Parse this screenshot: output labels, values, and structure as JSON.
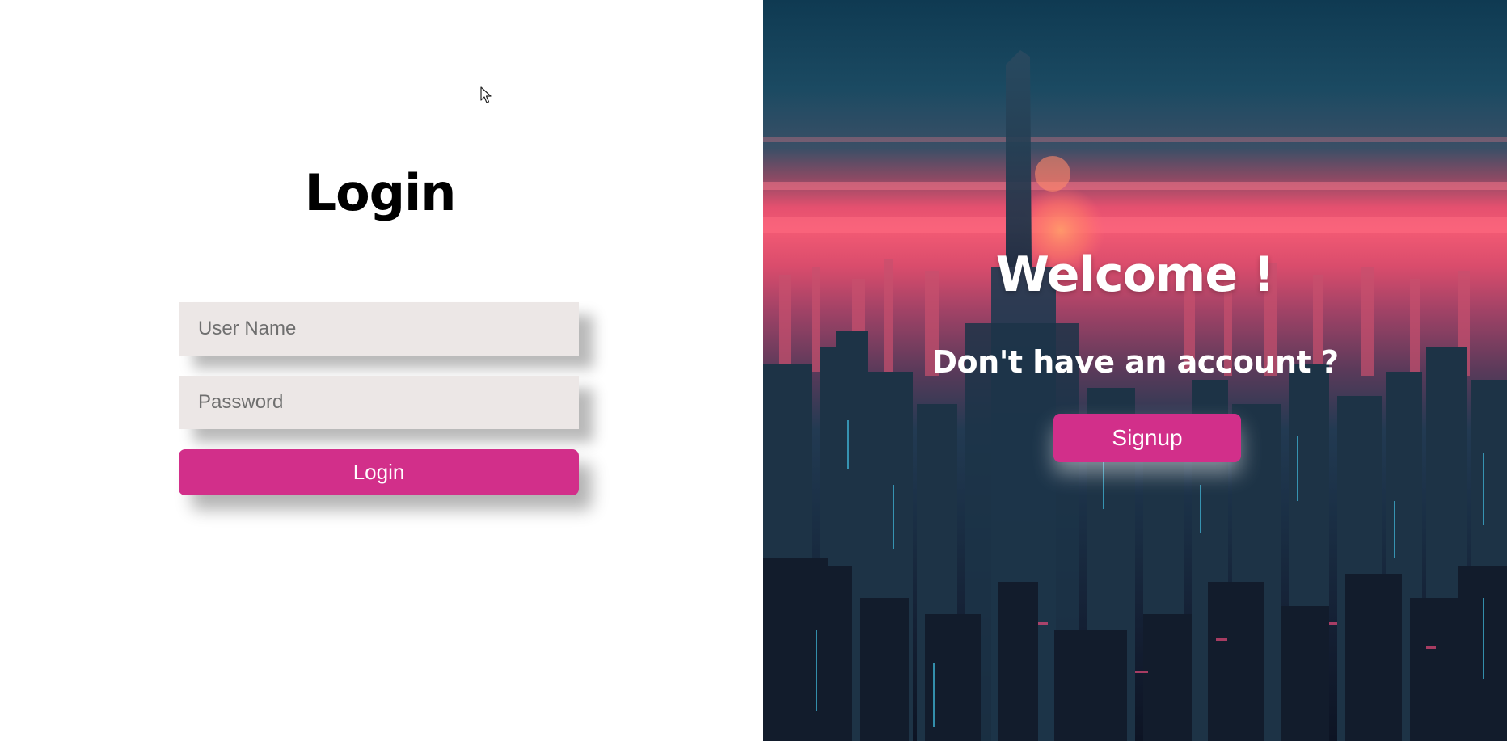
{
  "login_panel": {
    "title": "Login",
    "username_placeholder": "User Name",
    "password_placeholder": "Password",
    "login_button_label": "Login"
  },
  "welcome_panel": {
    "title": "Welcome !",
    "subtitle": "Don't have an account ?",
    "signup_button_label": "Signup"
  },
  "colors": {
    "accent": "#d22f8a",
    "field_background": "#ece7e6",
    "left_background": "#ffffff"
  },
  "icons": {
    "cursor": "mouse-pointer-icon"
  }
}
